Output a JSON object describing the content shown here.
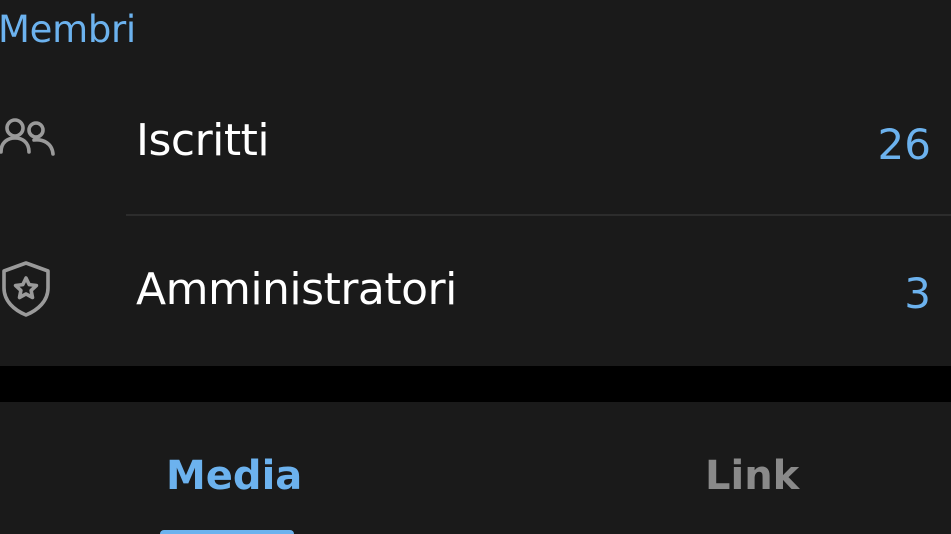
{
  "theme": {
    "background": "#1a1a1a",
    "separator": "#000000",
    "accent": "#6cb2ee",
    "text_primary": "#ffffff",
    "text_inactive": "#8a8a8a"
  },
  "members_section": {
    "title": "Membri",
    "rows": [
      {
        "icon": "people-icon",
        "label": "Iscritti",
        "value": "26"
      },
      {
        "icon": "shield-star-icon",
        "label": "Amministratori",
        "value": "3"
      }
    ]
  },
  "tabs": [
    {
      "label": "Media",
      "active": true
    },
    {
      "label": "Link",
      "active": false
    }
  ]
}
